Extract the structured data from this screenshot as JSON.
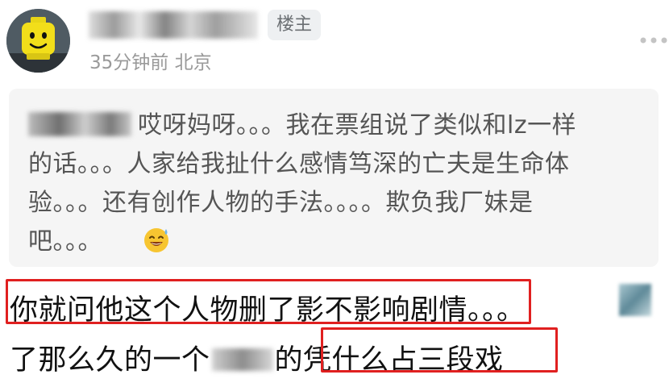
{
  "post": {
    "op_badge": "楼主",
    "meta": "35分钟前 北京"
  },
  "quote": {
    "line1": "哎呀妈呀。。。我在票组说了类似和lz一样",
    "line2": "的话。。。人家给我扯什么感情笃深的亡夫是生命体",
    "line3": "验。。。还有创作人物的手法。。。。欺负我厂妹是",
    "line4": "吧。。。"
  },
  "reply": {
    "highlight1": "你就问他这个人物删了影不影响剧情",
    "after_highlight1": "。。。",
    "line2_start": "了那么久的一个",
    "line2_mid": "的",
    "highlight2": "凭什么占三段戏"
  },
  "icons": {
    "more": "more-dots-icon",
    "emoji": "sweat-smile-emoji-icon",
    "avatar": "lego-avatar"
  },
  "colors": {
    "highlight_border": "#e02020",
    "quote_bg": "#f5f5f5",
    "meta_text": "#9a9a9a"
  }
}
